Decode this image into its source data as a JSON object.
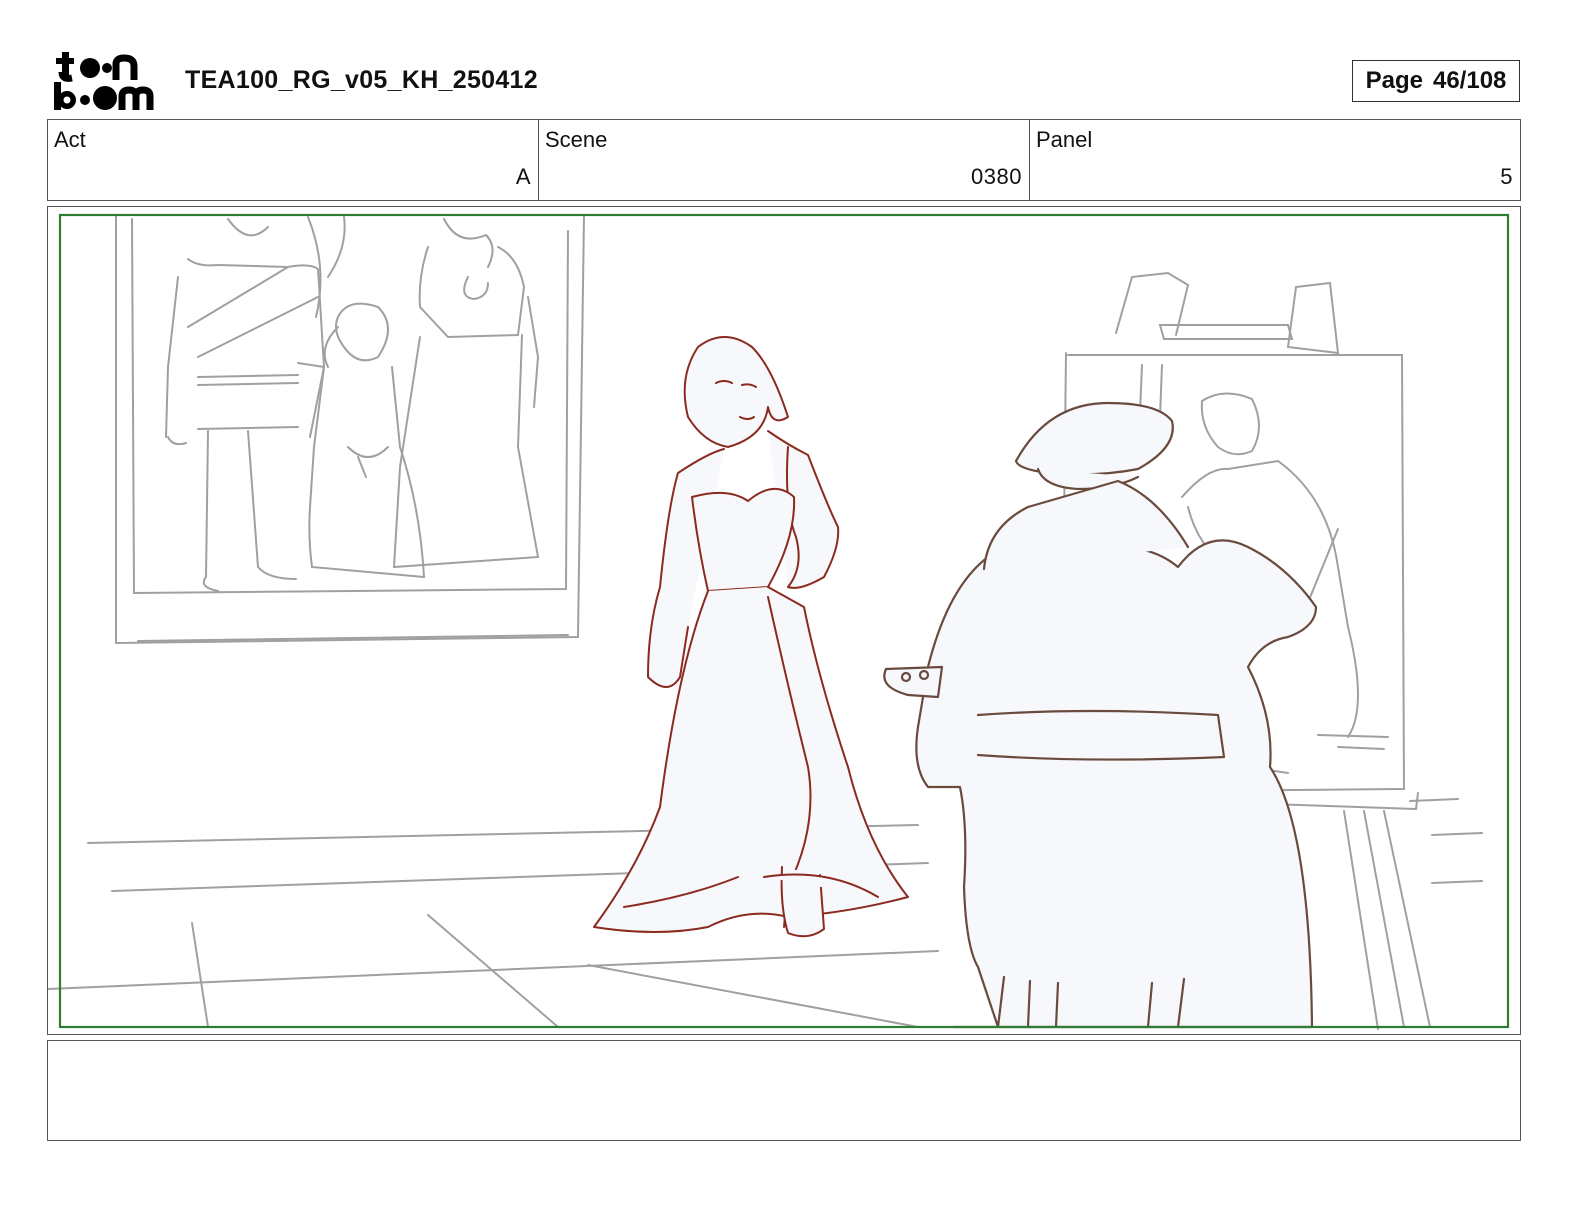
{
  "logo": {
    "line1": "toon",
    "line2": "boom"
  },
  "header": {
    "title": "TEA100_RG_v05_KH_250412",
    "page_label": "Page",
    "page_value": "46/108"
  },
  "info": {
    "act_label": "Act",
    "act_value": "A",
    "scene_label": "Scene",
    "scene_value": "0380",
    "panel_label": "Panel",
    "panel_value": "5"
  },
  "notes": {
    "text": ""
  },
  "colors": {
    "frame": "#2e7d32",
    "character": "#8b2a1e",
    "painter": "#6b4a3e",
    "background": "#9a9a9a"
  }
}
